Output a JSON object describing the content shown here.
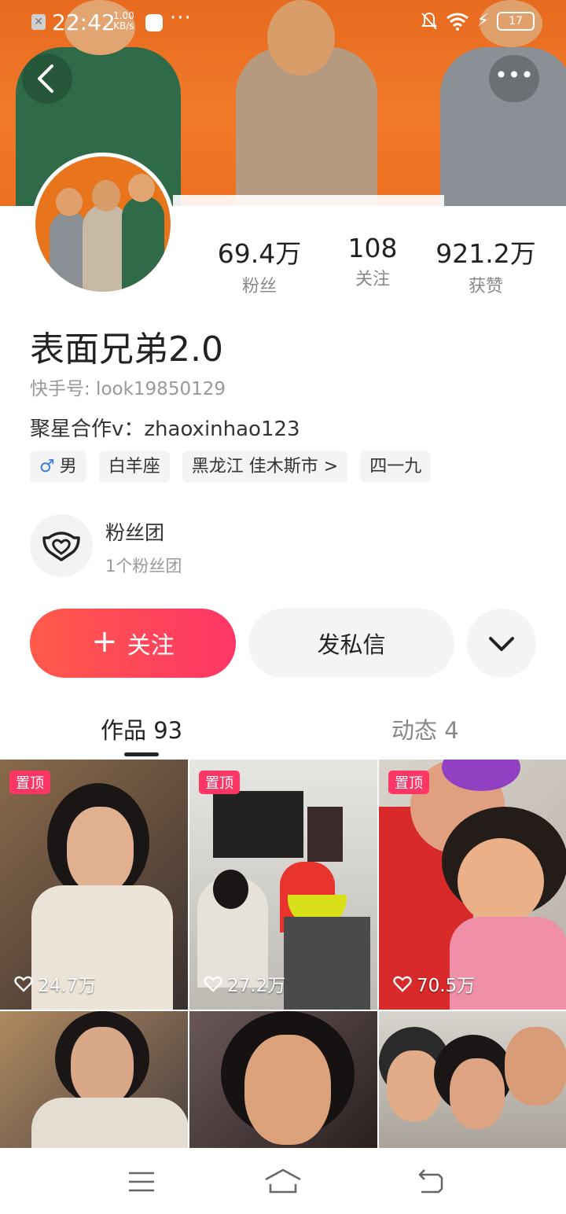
{
  "status_bar": {
    "time": "22:42",
    "net_speed_value": "1.00",
    "net_speed_unit": "KB/s",
    "battery": "17"
  },
  "profile": {
    "name": "表面兄弟2.0",
    "kuaishou_id": "快手号: look19850129",
    "bio": "聚星合作v：zhaoxinhao123",
    "tags": {
      "gender": "男",
      "zodiac": "白羊座",
      "location": "黑龙江 佳木斯市 >",
      "extra": "四一九"
    }
  },
  "stats": {
    "fans": {
      "value": "69.4万",
      "label": "粉丝"
    },
    "following": {
      "value": "108",
      "label": "关注"
    },
    "likes": {
      "value": "921.2万",
      "label": "获赞"
    }
  },
  "fan_group": {
    "title": "粉丝团",
    "subtitle": "1个粉丝团"
  },
  "actions": {
    "follow": "关注",
    "message": "发私信"
  },
  "tabs": {
    "works": "作品 93",
    "moments": "动态 4"
  },
  "videos": [
    {
      "pinned": "置顶",
      "likes": "24.7万",
      "bg": "#8a6a4a"
    },
    {
      "pinned": "置顶",
      "likes": "27.2万",
      "bg": "#d8d8d4"
    },
    {
      "pinned": "置顶",
      "likes": "70.5万",
      "bg": "#c85c70"
    },
    {
      "pinned": "",
      "likes": "",
      "bg": "#6b5a4e"
    },
    {
      "pinned": "",
      "likes": "",
      "bg": "#4a4040"
    },
    {
      "pinned": "",
      "likes": "",
      "bg": "#b8b4ae"
    }
  ],
  "colors": {
    "accent": "#fe3666",
    "banner": "#ee6f20"
  }
}
